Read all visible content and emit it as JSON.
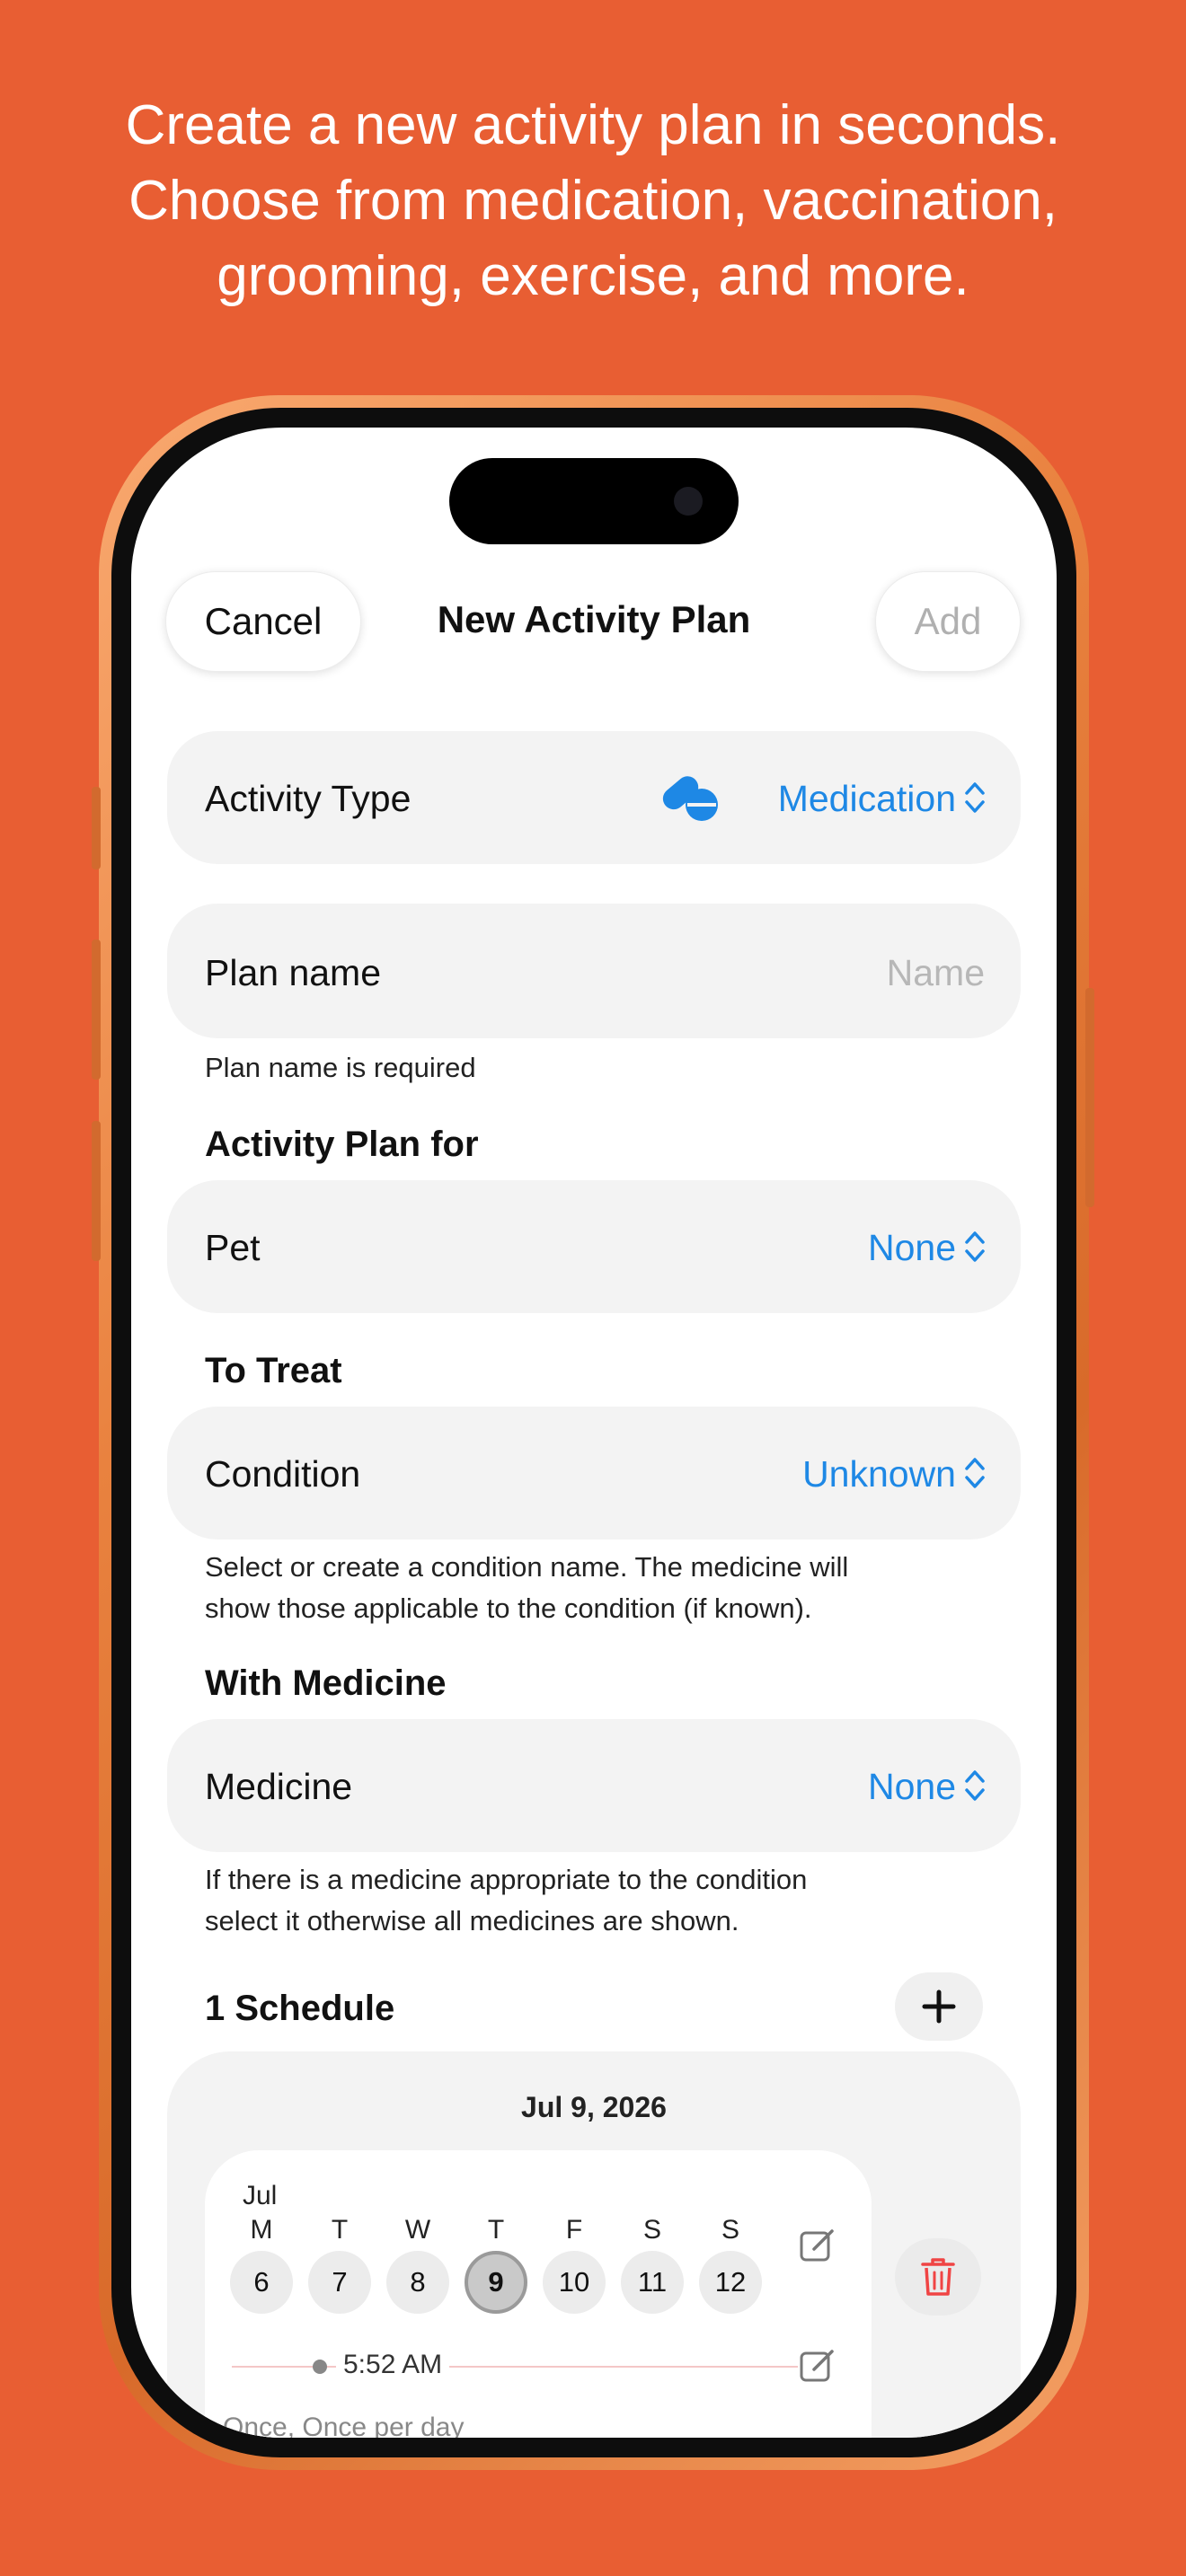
{
  "headline": [
    "Create a new activity plan in seconds.",
    "Choose from medication, vaccination,",
    "grooming, exercise, and more."
  ],
  "nav": {
    "cancel_label": "Cancel",
    "title": "New Activity Plan",
    "add_label": "Add"
  },
  "activity_type": {
    "label": "Activity Type",
    "value": "Medication",
    "icon": "pills-icon"
  },
  "plan_name": {
    "label": "Plan name",
    "placeholder": "Name",
    "footnote": "Plan name is required"
  },
  "plan_for": {
    "section": "Activity Plan for",
    "label": "Pet",
    "value": "None"
  },
  "to_treat": {
    "section": "To Treat",
    "label": "Condition",
    "value": "Unknown",
    "footnote_lines": [
      "Select or create a condition name. The medicine will",
      "show those applicable to the condition (if known)."
    ]
  },
  "with_medicine": {
    "section": "With Medicine",
    "label": "Medicine",
    "value": "None",
    "footnote_lines": [
      "If there is a medicine appropriate to the condition",
      "select it otherwise all medicines are shown."
    ]
  },
  "schedule": {
    "section": "1 Schedule",
    "date": "Jul 9, 2026",
    "month": "Jul",
    "days": [
      {
        "letter": "M",
        "num": "6"
      },
      {
        "letter": "T",
        "num": "7"
      },
      {
        "letter": "W",
        "num": "8"
      },
      {
        "letter": "T",
        "num": "9",
        "selected": true
      },
      {
        "letter": "F",
        "num": "10"
      },
      {
        "letter": "S",
        "num": "11"
      },
      {
        "letter": "S",
        "num": "12"
      }
    ],
    "time": "5:52 AM",
    "frequency": "Once, Once per day"
  },
  "colors": {
    "background": "#E85E33",
    "accent": "#1E88E5",
    "delete": "#F04444"
  }
}
